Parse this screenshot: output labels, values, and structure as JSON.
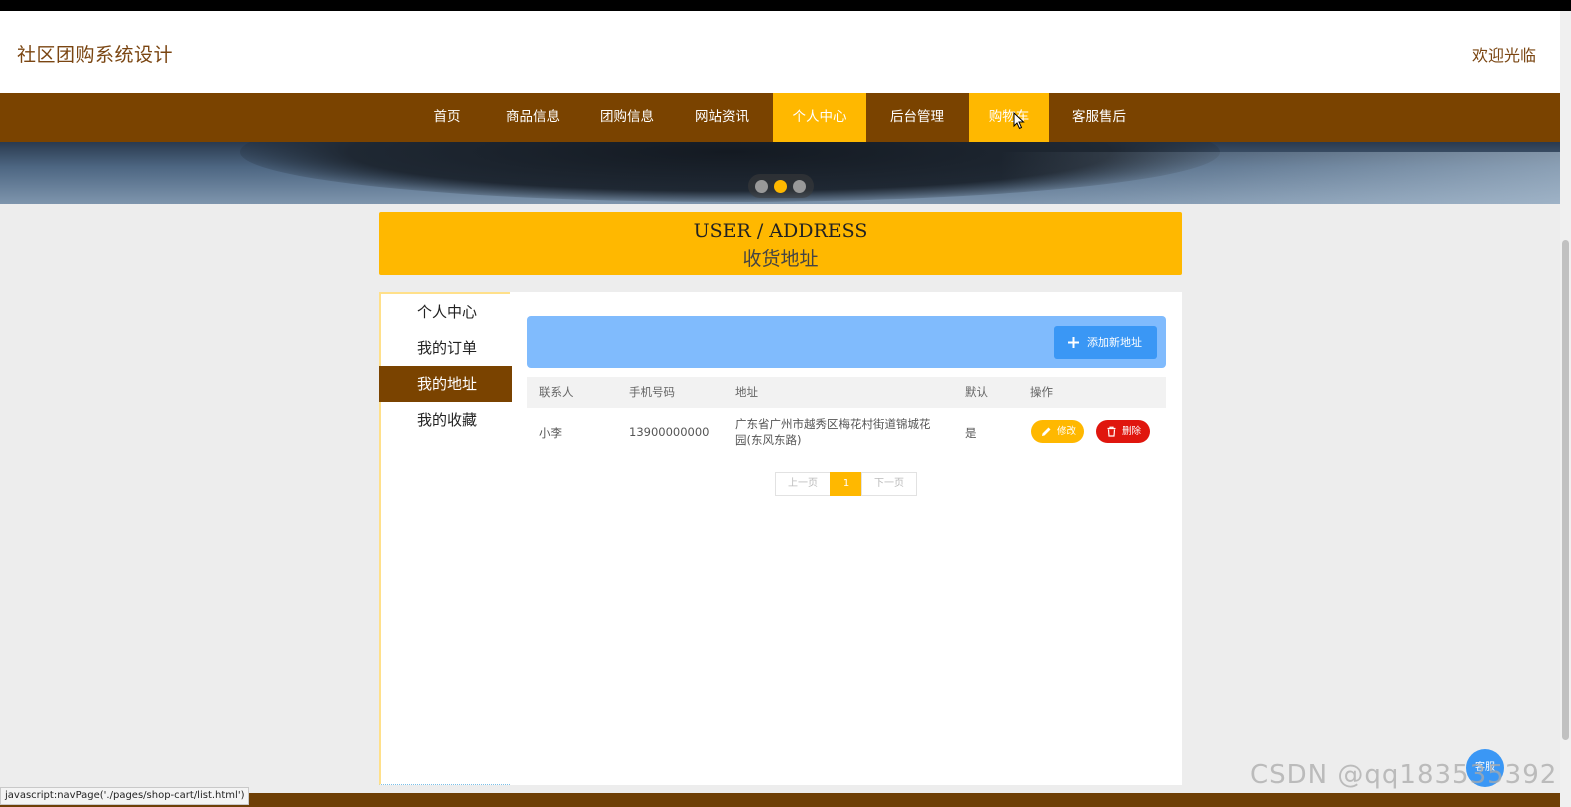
{
  "header": {
    "site_title": "社区团购系统设计",
    "welcome": "欢迎光临"
  },
  "nav": {
    "items": [
      "首页",
      "商品信息",
      "团购信息",
      "网站资讯",
      "个人中心",
      "后台管理",
      "购物车",
      "客服售后"
    ],
    "active": "个人中心",
    "hovered": "购物车"
  },
  "banner": {
    "slide_count": 3,
    "active_slide": 2
  },
  "section_title": {
    "en": "USER / ADDRESS",
    "cn": "收货地址"
  },
  "sidebar": {
    "items": [
      "个人中心",
      "我的订单",
      "我的地址",
      "我的收藏"
    ],
    "active": "我的地址"
  },
  "toolbar": {
    "add_label": "添加新地址"
  },
  "table": {
    "headers": [
      "联系人",
      "手机号码",
      "地址",
      "默认",
      "操作"
    ],
    "rows": [
      {
        "contact": "小李",
        "phone": "13900000000",
        "address": "广东省广州市越秀区梅花村街道锦城花园(东风东路)",
        "is_default": "是",
        "edit_label": "修改",
        "delete_label": "删除"
      }
    ]
  },
  "pagination": {
    "prev": "上一页",
    "current": "1",
    "next": "下一页"
  },
  "status_bar": {
    "url": "javascript:navPage('./pages/shop-cart/list.html')"
  },
  "float_button": {
    "label": "客服"
  },
  "watermark": "CSDN @qq183535392",
  "colors": {
    "brown": "#7a4300",
    "gold": "#ffb800",
    "blue": "#3a97f5",
    "light_blue": "#80bbfd",
    "red": "#e0160e"
  }
}
